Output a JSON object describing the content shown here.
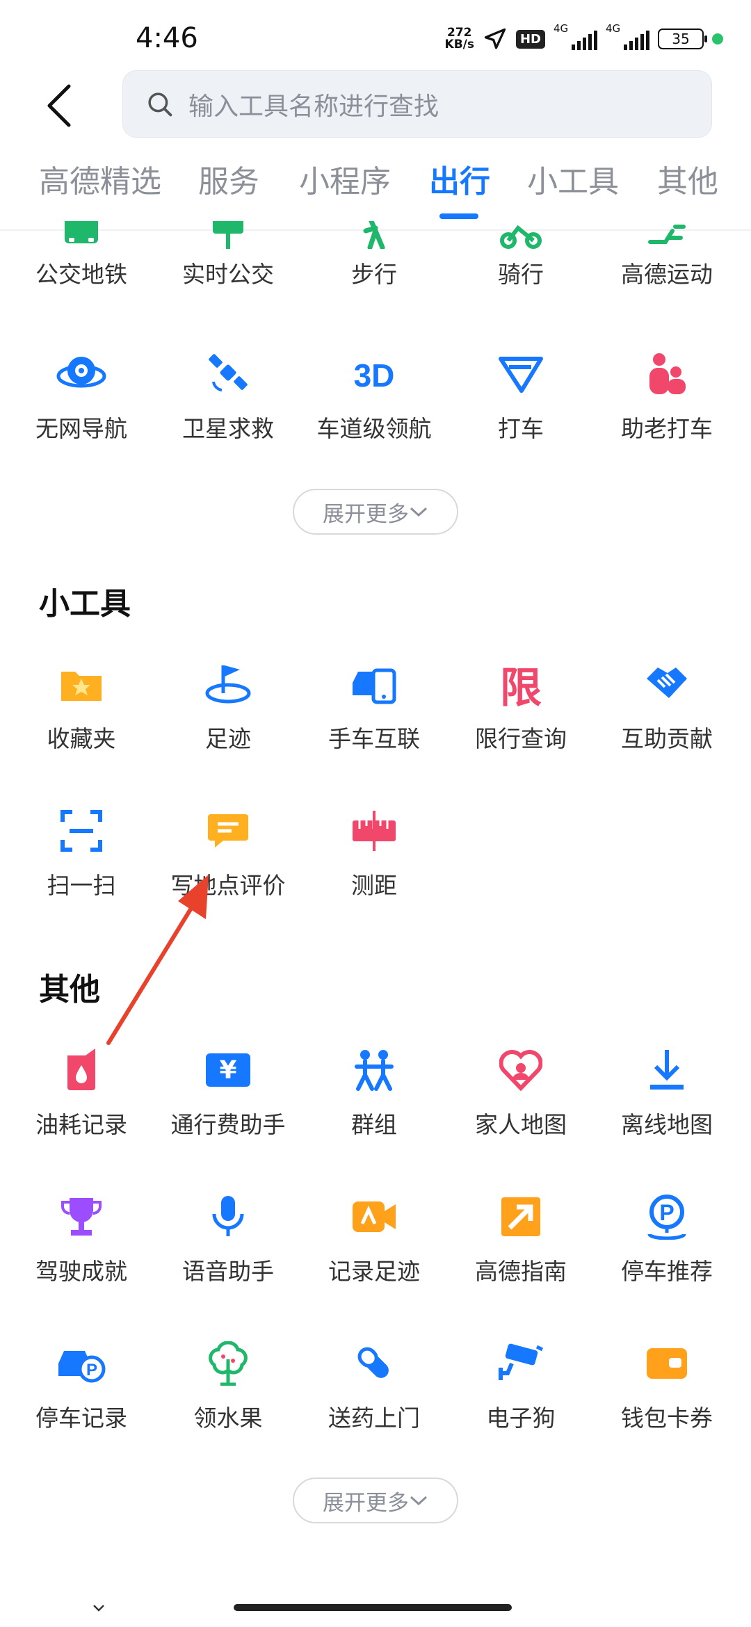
{
  "status_bar": {
    "time": "4:46",
    "net_speed_value": "272",
    "net_speed_unit": "KB/s",
    "hd_label": "HD",
    "signal1_label": "4G",
    "signal2_label": "4G",
    "battery": "35"
  },
  "search": {
    "placeholder": "输入工具名称进行查找"
  },
  "tabs": [
    {
      "label": "高德精选",
      "active": false
    },
    {
      "label": "服务",
      "active": false
    },
    {
      "label": "小程序",
      "active": false
    },
    {
      "label": "出行",
      "active": true
    },
    {
      "label": "小工具",
      "active": false
    },
    {
      "label": "其他",
      "active": false
    }
  ],
  "travel": {
    "items": [
      {
        "label": "公交地铁",
        "icon": "bus-icon",
        "color": "#1fb86b"
      },
      {
        "label": "实时公交",
        "icon": "bus-stop-icon",
        "color": "#1fb86b"
      },
      {
        "label": "步行",
        "icon": "walk-icon",
        "color": "#1fb86b"
      },
      {
        "label": "骑行",
        "icon": "bike-icon",
        "color": "#1fb86b"
      },
      {
        "label": "高德运动",
        "icon": "running-icon",
        "color": "#1fb86b"
      },
      {
        "label": "无网导航",
        "icon": "offline-nav-icon",
        "color": "#1677ff"
      },
      {
        "label": "卫星求救",
        "icon": "satellite-icon",
        "color": "#1677ff"
      },
      {
        "label": "车道级领航",
        "icon": "3d-lane-icon",
        "color": "#1677ff"
      },
      {
        "label": "打车",
        "icon": "taxi-icon",
        "color": "#1677ff"
      },
      {
        "label": "助老打车",
        "icon": "elder-taxi-icon",
        "color": "#f0476a"
      }
    ],
    "expand_label": "展开更多"
  },
  "tools": {
    "title": "小工具",
    "items": [
      {
        "label": "收藏夹",
        "icon": "favorites-icon",
        "color": "#ffb020"
      },
      {
        "label": "足迹",
        "icon": "footprint-icon",
        "color": "#1677ff"
      },
      {
        "label": "手车互联",
        "icon": "phone-car-icon",
        "color": "#1677ff"
      },
      {
        "label": "限行查询",
        "icon": "restriction-icon",
        "color": "#f0476a",
        "glyph": "限"
      },
      {
        "label": "互助贡献",
        "icon": "handshake-icon",
        "color": "#1677ff"
      },
      {
        "label": "扫一扫",
        "icon": "scan-icon",
        "color": "#1677ff"
      },
      {
        "label": "写地点评价",
        "icon": "review-icon",
        "color": "#ffb020"
      },
      {
        "label": "测距",
        "icon": "ruler-icon",
        "color": "#f0476a"
      }
    ]
  },
  "others": {
    "title": "其他",
    "items": [
      {
        "label": "油耗记录",
        "icon": "fuel-icon",
        "color": "#f0476a"
      },
      {
        "label": "通行费助手",
        "icon": "toll-icon",
        "color": "#1677ff",
        "glyph": "¥"
      },
      {
        "label": "群组",
        "icon": "group-icon",
        "color": "#1677ff"
      },
      {
        "label": "家人地图",
        "icon": "family-map-icon",
        "color": "#f0476a"
      },
      {
        "label": "离线地图",
        "icon": "download-icon",
        "color": "#1677ff"
      },
      {
        "label": "驾驶成就",
        "icon": "trophy-icon",
        "color": "#9b4dff"
      },
      {
        "label": "语音助手",
        "icon": "microphone-icon",
        "color": "#1677ff"
      },
      {
        "label": "记录足迹",
        "icon": "video-record-icon",
        "color": "#ffa11a"
      },
      {
        "label": "高德指南",
        "icon": "guide-icon",
        "color": "#ffa11a"
      },
      {
        "label": "停车推荐",
        "icon": "parking-pin-icon",
        "color": "#1677ff",
        "glyph": "P"
      },
      {
        "label": "停车记录",
        "icon": "car-parking-icon",
        "color": "#1677ff"
      },
      {
        "label": "领水果",
        "icon": "tree-icon",
        "color": "#1fb86b"
      },
      {
        "label": "送药上门",
        "icon": "pill-icon",
        "color": "#1677ff"
      },
      {
        "label": "电子狗",
        "icon": "camera-icon",
        "color": "#1677ff"
      },
      {
        "label": "钱包卡券",
        "icon": "wallet-icon",
        "color": "#ffa11a"
      }
    ],
    "expand_label": "展开更多"
  }
}
